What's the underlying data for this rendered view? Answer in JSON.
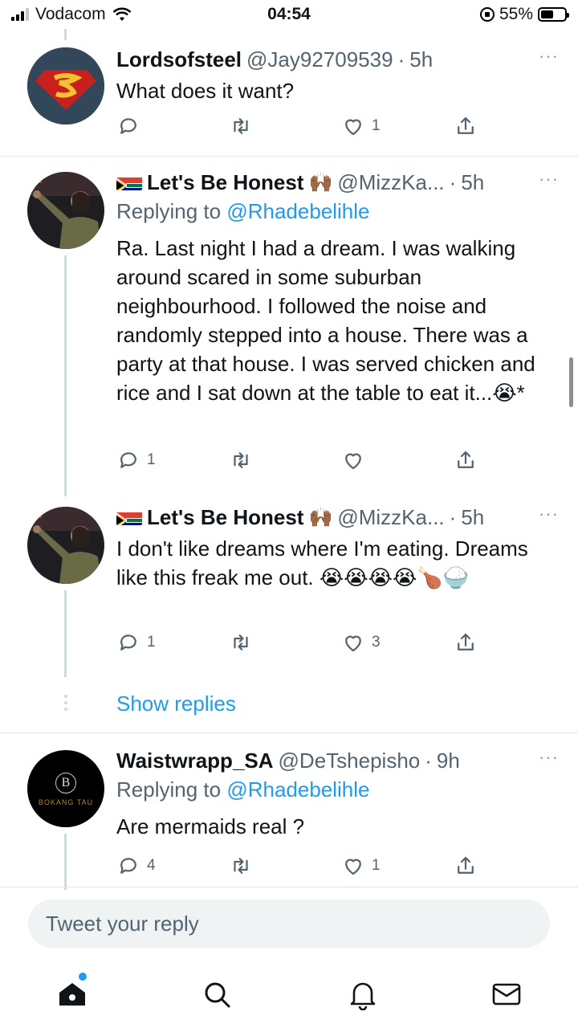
{
  "status_bar": {
    "carrier": "Vodacom",
    "time": "04:54",
    "battery": "55%",
    "battery_level": 0.55
  },
  "tweets": [
    {
      "name": "Lordsofsteel",
      "handle": "@Jay92709539",
      "time": "5h",
      "text": "What does it want?",
      "replies": "",
      "likes": "1",
      "avatar_icon": "superman-logo"
    },
    {
      "name": "Let's Be Honest",
      "handle": "@MizzKa...",
      "time": "5h",
      "replying_prefix": "Replying to",
      "replying_to": "@Rhadebelihle",
      "text": "Ra. Last night I had a dream. I was walking around scared in some suburban neighbourhood. I followed the noise and randomly stepped into a house. There was a party at that house. I was served chicken and rice and I sat down at the table to eat it...😭*",
      "replies": "1",
      "likes": "",
      "flag_icon": "south-africa-flag-icon",
      "hands_emoji": "🙌🏾"
    },
    {
      "name": "Let's Be Honest",
      "handle": "@MizzKa...",
      "time": "5h",
      "text": "I don't like dreams where I'm eating. Dreams like this freak me out. 😭😭😭😭🍗🍚",
      "replies": "1",
      "likes": "3",
      "flag_icon": "south-africa-flag-icon",
      "hands_emoji": "🙌🏾"
    },
    {
      "name": "Waistwrapp_SA",
      "handle": "@DeTshepisho",
      "time": "9h",
      "replying_prefix": "Replying to",
      "replying_to": "@Rhadebelihle",
      "text": "Are mermaids real ?",
      "replies": "4",
      "likes": "1",
      "avatar_text": "BOKANG TAU",
      "avatar_monogram": "B"
    }
  ],
  "show_replies": "Show replies",
  "reply_placeholder": "Tweet your reply",
  "time_separator": "·",
  "more_glyph": "···",
  "nav": [
    "home-icon",
    "search-icon",
    "bell-icon",
    "mail-icon"
  ],
  "colors": {
    "accent": "#1d9bf0",
    "text": "#0f1419",
    "muted": "#536471",
    "divider": "#e1e8ed"
  }
}
